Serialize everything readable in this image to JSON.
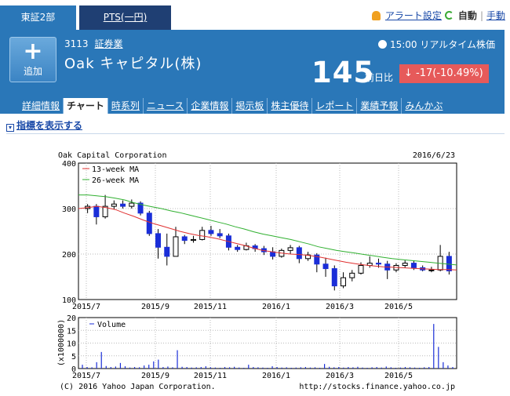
{
  "market_tabs": {
    "active": "東証2部",
    "pts": "PTS(一円)"
  },
  "top_links": {
    "alert": "アラート設定",
    "auto": "自動",
    "sep": "|",
    "manual": "手動"
  },
  "stock": {
    "add_label": "追加",
    "code": "3113",
    "sector": "証券業",
    "name": "Oak キャピタル(株)",
    "realtime": "15:00 リアルタイム株価",
    "price": "145",
    "prev_label": "前日比",
    "change": "-17(-10.49%)",
    "change_color": "#e65a5a"
  },
  "nav_tabs": [
    "詳細情報",
    "チャート",
    "時系列",
    "ニュース",
    "企業情報",
    "掲示板",
    "株主優待",
    "レポート",
    "業績予報",
    "みんかぶ"
  ],
  "nav_active": "チャート",
  "indicator_toggle": "指標を表示する",
  "chart": {
    "company": "Oak Capital Corporation",
    "date": "2016/6/23",
    "copyright": "(C) 2016 Yahoo Japan Corporation.",
    "url": "http://stocks.finance.yahoo.co.jp",
    "legend_ma13": "13-week MA",
    "legend_ma26": "26-week MA",
    "legend_volume": "Volume",
    "volume_unit": "(x1000000)",
    "colors": {
      "ma13": "#e03030",
      "ma26": "#30b030",
      "up": "#ffffff",
      "down": "#1a2ed8",
      "volume": "#1a2ed8"
    }
  },
  "chart_data": [
    {
      "type": "candlestick",
      "title": "Oak Capital Corporation",
      "ylim": [
        100,
        400
      ],
      "yticks": [
        "100",
        "200",
        "300",
        "400"
      ],
      "xticks": [
        "2015/7",
        "2015/9",
        "2015/11",
        "2016/1",
        "2016/3",
        "2016/5"
      ],
      "series": [
        {
          "name": "13-week MA",
          "values": [
            300,
            302,
            305,
            302,
            298,
            290,
            283,
            275,
            268,
            262,
            256,
            250,
            245,
            241,
            238,
            234,
            229,
            224,
            219,
            213,
            208,
            205,
            202,
            200,
            199,
            197,
            194,
            190,
            186,
            182,
            179,
            176,
            174,
            172,
            171,
            170,
            169,
            168,
            167,
            166,
            166,
            165
          ]
        },
        {
          "name": "26-week MA",
          "values": [
            330,
            330,
            328,
            326,
            323,
            319,
            313,
            308,
            304,
            300,
            295,
            291,
            286,
            281,
            276,
            271,
            266,
            260,
            255,
            249,
            244,
            240,
            236,
            232,
            227,
            222,
            216,
            212,
            208,
            205,
            202,
            199,
            196,
            193,
            190,
            188,
            186,
            184,
            182,
            180,
            178,
            176
          ]
        }
      ],
      "candles": [
        [
          300,
          305,
          290,
          310
        ],
        [
          305,
          282,
          265,
          310
        ],
        [
          282,
          305,
          278,
          330
        ],
        [
          305,
          310,
          298,
          318
        ],
        [
          310,
          305,
          300,
          318
        ],
        [
          305,
          312,
          300,
          320
        ],
        [
          312,
          290,
          285,
          316
        ],
        [
          290,
          245,
          240,
          295
        ],
        [
          245,
          215,
          190,
          255
        ],
        [
          215,
          195,
          175,
          245
        ],
        [
          195,
          238,
          195,
          260
        ],
        [
          238,
          230,
          222,
          242
        ],
        [
          230,
          232,
          225,
          240
        ],
        [
          232,
          252,
          230,
          260
        ],
        [
          252,
          245,
          240,
          262
        ],
        [
          245,
          240,
          235,
          255
        ],
        [
          240,
          215,
          208,
          245
        ],
        [
          215,
          210,
          205,
          220
        ],
        [
          210,
          218,
          208,
          225
        ],
        [
          218,
          212,
          205,
          222
        ],
        [
          212,
          205,
          198,
          218
        ],
        [
          205,
          195,
          188,
          215
        ],
        [
          195,
          208,
          192,
          212
        ],
        [
          208,
          214,
          200,
          220
        ],
        [
          214,
          190,
          180,
          218
        ],
        [
          190,
          198,
          185,
          205
        ],
        [
          198,
          178,
          160,
          202
        ],
        [
          178,
          168,
          150,
          192
        ],
        [
          168,
          130,
          120,
          175
        ],
        [
          130,
          148,
          125,
          160
        ],
        [
          148,
          158,
          140,
          165
        ],
        [
          158,
          175,
          155,
          182
        ],
        [
          175,
          180,
          170,
          195
        ],
        [
          180,
          178,
          170,
          190
        ],
        [
          178,
          165,
          145,
          185
        ],
        [
          165,
          175,
          160,
          180
        ],
        [
          175,
          180,
          170,
          186
        ],
        [
          180,
          170,
          165,
          185
        ],
        [
          170,
          165,
          162,
          175
        ],
        [
          165,
          165,
          160,
          172
        ],
        [
          165,
          195,
          162,
          220
        ],
        [
          195,
          163,
          155,
          205
        ]
      ]
    },
    {
      "type": "bar",
      "title": "Volume",
      "ylabel": "(x1000000)",
      "ylim": [
        0,
        20
      ],
      "yticks": [
        "0",
        "5",
        "10",
        "15",
        "20"
      ],
      "values": [
        1.5,
        0.6,
        0.5,
        2.5,
        6.5,
        1.0,
        0.6,
        0.8,
        2.2,
        0.9,
        0.4,
        0.6,
        0.5,
        1.2,
        1.5,
        2.8,
        3.5,
        0.6,
        0.8,
        0.5,
        7.2,
        0.7,
        0.6,
        0.4,
        0.5,
        0.6,
        0.9,
        0.5,
        0.4,
        0.3,
        0.6,
        0.5,
        0.7,
        0.4,
        0.3,
        1.5,
        0.6,
        0.5,
        0.4,
        0.3,
        0.9,
        0.6,
        0.4,
        0.5,
        0.3,
        0.4,
        0.5,
        0.6,
        0.4,
        0.5,
        0.3,
        1.8,
        0.7,
        0.5,
        0.6,
        0.4,
        0.6,
        0.5,
        0.7,
        0.4,
        0.3,
        0.5,
        0.6,
        0.4,
        0.8,
        0.5,
        0.3,
        0.4,
        0.6,
        0.5,
        0.4,
        0.3,
        0.5,
        0.6,
        17.5,
        8.5,
        2.5,
        1.2,
        0.6
      ]
    }
  ]
}
